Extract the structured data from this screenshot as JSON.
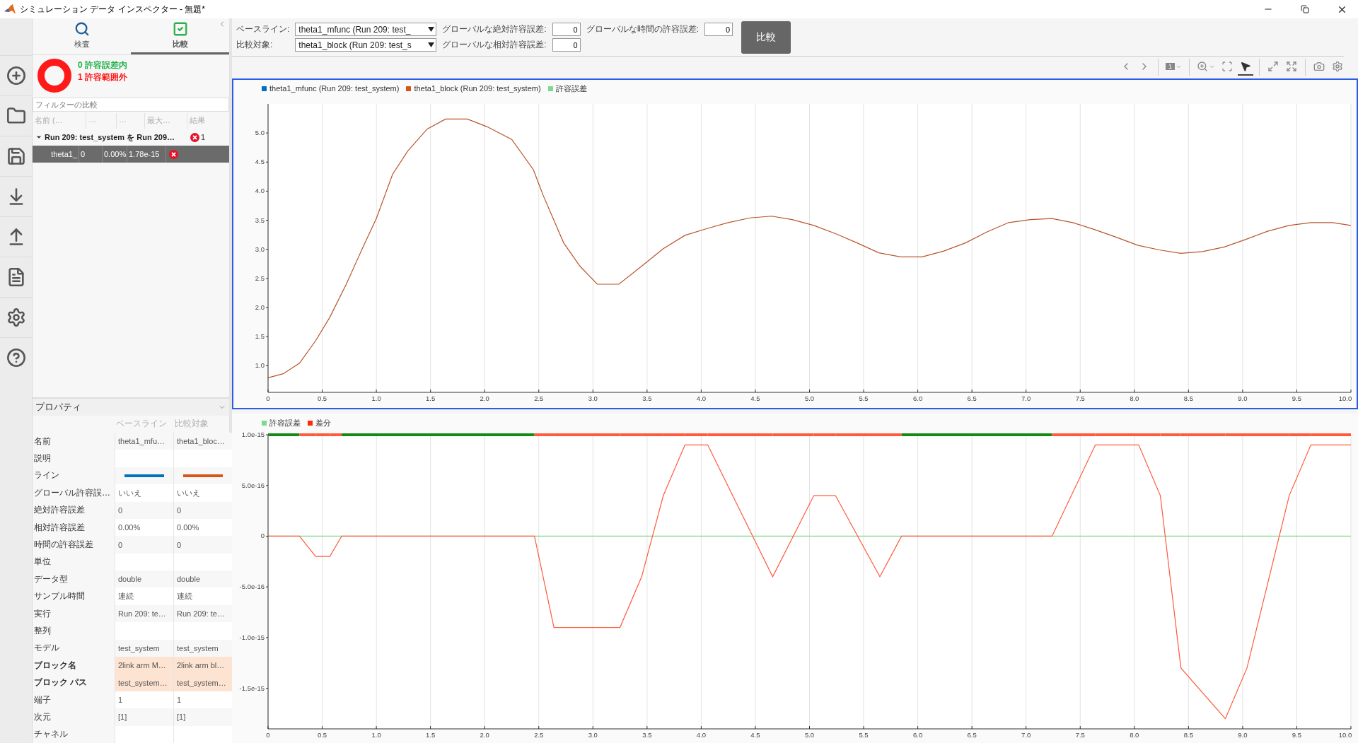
{
  "window": {
    "title": "シミュレーション データ インスペクター - 無題*"
  },
  "side_tabs": [
    {
      "label": "検査",
      "selected": false
    },
    {
      "label": "比較",
      "selected": true
    }
  ],
  "summary": {
    "items": [
      {
        "label": "0 許容誤差内",
        "color": "#22b14c"
      },
      {
        "label": "1 許容範囲外",
        "color": "#ff1a1a"
      }
    ]
  },
  "filter": {
    "placeholder": "フィルターの比較"
  },
  "comparison_table": {
    "columns": [
      "名前 (…",
      "…",
      "…",
      "最大…",
      "結果"
    ],
    "rows": [
      {
        "name": "Run 209: test_system を Run 209…",
        "expanded": true,
        "selected": false,
        "passed": false,
        "result_count": "1",
        "children": [
          {
            "name": "theta1_",
            "column_2": "0",
            "column_3": "0.00%",
            "column_4": "1.78e-15",
            "passed": false,
            "selected": true
          }
        ]
      }
    ]
  },
  "properties": {
    "title": "プロパティ",
    "expanded": true,
    "columns": [
      "ベースライン",
      "比較対象"
    ],
    "rows": [
      {
        "kind": "text",
        "label": "名前",
        "values": [
          "theta1_mfu…",
          "theta1_bloc…"
        ],
        "differs": false
      },
      {
        "kind": "text",
        "label": "説明",
        "values": [],
        "differs": false
      },
      {
        "kind": "line",
        "label": "ライン",
        "lines": [
          {
            "color": "#0072bd"
          },
          {
            "color": "#d95319"
          }
        ],
        "differs": false
      },
      {
        "kind": "text",
        "label": "グローバル許容誤…",
        "values": [
          "いいえ",
          "いいえ"
        ],
        "differs": false
      },
      {
        "kind": "text",
        "label": "絶対許容誤差",
        "values": [
          "0",
          "0"
        ],
        "differs": false
      },
      {
        "kind": "text",
        "label": "相対許容誤差",
        "values": [
          "0.00%",
          "0.00%"
        ],
        "differs": false
      },
      {
        "kind": "text",
        "label": "時間の許容誤差",
        "values": [
          "0",
          "0"
        ],
        "differs": false
      },
      {
        "kind": "text",
        "label": "単位",
        "values": [],
        "differs": false
      },
      {
        "kind": "text",
        "label": "データ型",
        "values": [
          "double",
          "double"
        ],
        "differs": false
      },
      {
        "kind": "text",
        "label": "サンプル時間",
        "values": [
          "連続",
          "連続"
        ],
        "differs": false
      },
      {
        "kind": "text",
        "label": "実行",
        "values": [
          "Run 209: te…",
          "Run 209: te…"
        ],
        "differs": false
      },
      {
        "kind": "text",
        "label": "整列",
        "values": [],
        "differs": false
      },
      {
        "kind": "text",
        "label": "モデル",
        "values": [
          "test_system",
          "test_system"
        ],
        "differs": false
      },
      {
        "kind": "text",
        "label": "ブロック名",
        "values": [
          "2link arm M…",
          "2link arm bl…"
        ],
        "differs": true
      },
      {
        "kind": "text",
        "label": "ブロック パス",
        "values": [
          "test_system…",
          "test_system…"
        ],
        "differs": true
      },
      {
        "kind": "text",
        "label": "端子",
        "values": [
          "1",
          "1"
        ],
        "differs": false
      },
      {
        "kind": "text",
        "label": "次元",
        "values": [
          "[1]",
          "[1]"
        ],
        "differs": false
      },
      {
        "kind": "text",
        "label": "チャネル",
        "values": [],
        "differs": false
      }
    ]
  },
  "compare_settings": {
    "baseline": {
      "label": "ベースライン:",
      "value": "theta1_mfunc (Run 209: test_"
    },
    "compare_to": {
      "label": "比較対象:",
      "value": "theta1_block (Run 209: test_s"
    },
    "tolerances": [
      {
        "label": "グローバルな絶対許容誤差:",
        "value": "0"
      },
      {
        "label": "グローバルな相対許容誤差:",
        "value": "0"
      },
      {
        "label": "グローバルな時間の許容誤差:",
        "value": "0"
      }
    ],
    "compare_button": "比較"
  },
  "plot_toolbar": {
    "layout_number": "1",
    "tools": [
      {
        "selected": false
      },
      {
        "selected": false
      },
      {
        "selected": false
      },
      {
        "selected": false
      },
      {
        "selected": false
      },
      {
        "selected": true
      },
      {
        "selected": false
      },
      {
        "selected": false
      },
      {
        "selected": false
      },
      {
        "selected": false
      }
    ]
  },
  "plots": [
    {
      "selected": true,
      "legend": [
        {
          "label": "theta1_mfunc (Run 209: test_system)",
          "color": "#0072bd"
        },
        {
          "label": "theta1_block (Run 209: test_system)",
          "color": "#d95319"
        },
        {
          "label": "許容誤差",
          "color": "#7fd98a"
        }
      ],
      "chart_data": {
        "type": "line",
        "grid": true,
        "x": [
          0,
          0.14,
          0.29,
          0.44,
          0.57,
          0.72,
          0.86,
          1.0,
          1.15,
          1.29,
          1.47,
          1.64,
          1.84,
          2.02,
          2.25,
          2.45,
          2.54,
          2.73,
          2.88,
          3.04,
          3.24,
          3.45,
          3.65,
          3.85,
          4.06,
          4.25,
          4.45,
          4.65,
          4.84,
          5.04,
          5.24,
          5.44,
          5.64,
          5.84,
          6.04,
          6.24,
          6.44,
          6.64,
          6.84,
          7.04,
          7.24,
          7.43,
          7.63,
          7.83,
          8.03,
          8.23,
          8.43,
          8.63,
          8.83,
          9.03,
          9.23,
          9.43,
          9.63,
          9.83,
          10.0
        ],
        "series": [
          {
            "color": "#b8552a",
            "values": [
              0.79,
              0.86,
              1.04,
              1.43,
              1.83,
              2.39,
              2.97,
              3.53,
              4.29,
              4.69,
              5.07,
              5.24,
              5.24,
              5.11,
              4.89,
              4.37,
              3.93,
              3.11,
              2.71,
              2.4,
              2.4,
              2.71,
              3.01,
              3.24,
              3.36,
              3.46,
              3.54,
              3.57,
              3.51,
              3.41,
              3.27,
              3.11,
              2.94,
              2.87,
              2.87,
              2.97,
              3.11,
              3.3,
              3.46,
              3.51,
              3.53,
              3.46,
              3.34,
              3.21,
              3.07,
              2.99,
              2.93,
              2.96,
              3.04,
              3.17,
              3.31,
              3.41,
              3.46,
              3.46,
              3.41
            ]
          }
        ],
        "xlim": [
          0,
          10
        ],
        "ylim": [
          0.54,
          5.5
        ],
        "xticks": [
          0,
          0.5,
          {
            "value": 1,
            "label": "1.0"
          },
          1.5,
          {
            "value": 2,
            "label": "2.0"
          },
          2.5,
          {
            "value": 3,
            "label": "3.0"
          },
          3.5,
          {
            "value": 4,
            "label": "4.0"
          },
          4.5,
          {
            "value": 5,
            "label": "5.0"
          },
          5.5,
          {
            "value": 6,
            "label": "6.0"
          },
          6.5,
          {
            "value": 7,
            "label": "7.0"
          },
          7.5,
          {
            "value": 8,
            "label": "8.0"
          },
          8.5,
          {
            "value": 9,
            "label": "9.0"
          },
          9.5,
          {
            "value": 10,
            "label": "10.0"
          }
        ],
        "yticks": [
          {
            "value": 1,
            "label": "1.0"
          },
          1.5,
          {
            "value": 2,
            "label": "2.0"
          },
          2.5,
          {
            "value": 3,
            "label": "3.0"
          },
          3.5,
          {
            "value": 4,
            "label": "4.0"
          },
          4.5,
          {
            "value": 5,
            "label": "5.0"
          }
        ]
      }
    },
    {
      "selected": false,
      "legend": [
        {
          "label": "許容誤差",
          "color": "#7fd98a"
        },
        {
          "label": "差分",
          "color": "#ff2a00"
        }
      ],
      "chart_data": {
        "type": "line",
        "grid": true,
        "x": [
          0,
          0.29,
          0.44,
          0.57,
          0.68,
          2.46,
          2.64,
          3.25,
          3.45,
          3.65,
          3.85,
          4.06,
          4.66,
          5.04,
          5.24,
          5.65,
          5.85,
          7.24,
          7.64,
          8.04,
          8.24,
          8.43,
          8.84,
          9.04,
          9.43,
          9.63,
          10.0
        ],
        "series": [
          {
            "color": "#7fd98a",
            "values": [
              0,
              0,
              0,
              0,
              0,
              0,
              0,
              0,
              0,
              0,
              0,
              0,
              0,
              0,
              0,
              0,
              0,
              0,
              0,
              0,
              0,
              0,
              0,
              0,
              0,
              0,
              0
            ]
          },
          {
            "color": "#ff5a3c",
            "values": [
              0,
              0,
              -2e-16,
              -2e-16,
              0,
              0,
              -9e-16,
              -9e-16,
              -4e-16,
              4e-16,
              9e-16,
              9e-16,
              -4e-16,
              4e-16,
              4e-16,
              -4e-16,
              0,
              0,
              9e-16,
              9e-16,
              4e-16,
              -1.3e-15,
              -1.8e-15,
              -1.3e-15,
              4e-16,
              9e-16,
              9e-16
            ]
          }
        ],
        "xlim": [
          0,
          10
        ],
        "ylim": [
          -1.9e-15,
          1e-15
        ],
        "xticks": [
          0,
          0.5,
          {
            "value": 1,
            "label": "1.0"
          },
          1.5,
          {
            "value": 2,
            "label": "2.0"
          },
          2.5,
          {
            "value": 3,
            "label": "3.0"
          },
          3.5,
          {
            "value": 4,
            "label": "4.0"
          },
          4.5,
          {
            "value": 5,
            "label": "5.0"
          },
          5.5,
          {
            "value": 6,
            "label": "6.0"
          },
          6.5,
          {
            "value": 7,
            "label": "7.0"
          },
          7.5,
          {
            "value": 8,
            "label": "8.0"
          },
          8.5,
          {
            "value": 9,
            "label": "9.0"
          },
          9.5,
          {
            "value": 10,
            "label": "10.0"
          }
        ],
        "yticks": [
          {
            "value": 1e-15,
            "label": "1.0e-15"
          },
          {
            "value": 5e-16,
            "label": "5.0e-16"
          },
          0,
          {
            "value": -5e-16,
            "label": "-5.0e-16"
          },
          {
            "value": -1e-15,
            "label": "-1.0e-15"
          },
          {
            "value": -1.5e-15,
            "label": "-1.5e-15"
          }
        ]
      }
    }
  ]
}
